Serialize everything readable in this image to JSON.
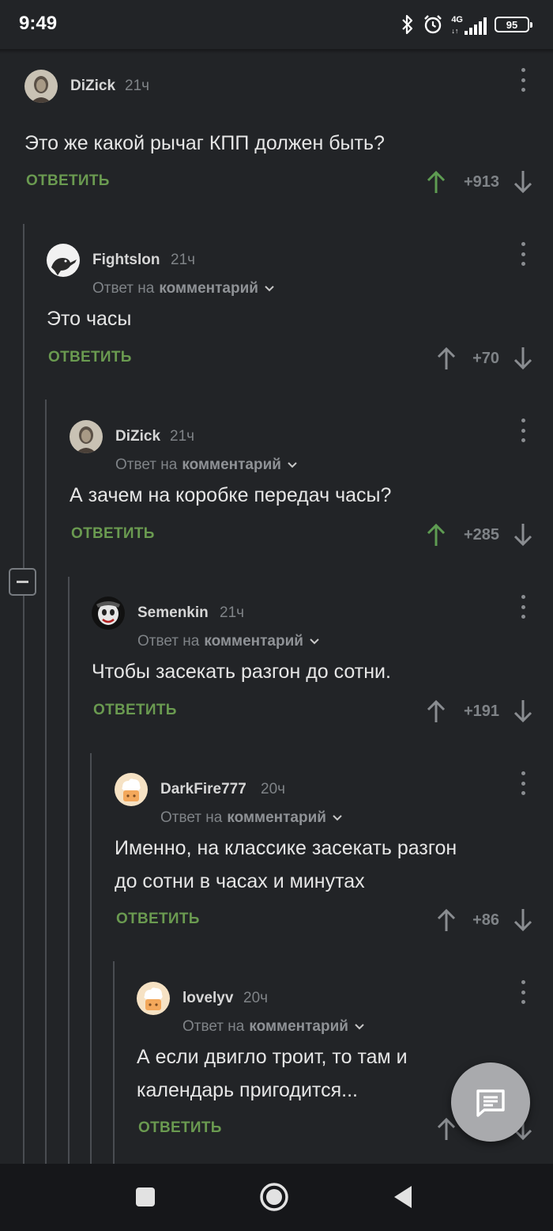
{
  "status_bar": {
    "time": "9:49",
    "network": "4G",
    "battery": "95",
    "icons": [
      "bluetooth-icon",
      "alarm-icon",
      "signal-icon",
      "battery-icon"
    ]
  },
  "colors": {
    "background": "#222427",
    "reply_green": "#6a9a50",
    "upvoted_green": "#5e9c52",
    "muted_gray": "#7f8387",
    "text": "#e6e6e6",
    "thread_line": "#4a4d52",
    "fab": "#a9aaad"
  },
  "reply_label": "ОТВЕТИТЬ",
  "reply_to_prefix": "Ответ на",
  "reply_to_target": "комментарий",
  "comments": [
    {
      "author": "DiZick",
      "time": "21ч",
      "text": "Это же какой рычаг КПП должен быть?",
      "rating": "+913",
      "upvoted": true,
      "avatar_icon": "portrait-avatar"
    },
    {
      "author": "Fightslon",
      "time": "21ч",
      "text": "Это часы",
      "rating": "+70",
      "upvoted": false,
      "avatar_icon": "elephant-avatar"
    },
    {
      "author": "DiZick",
      "time": "21ч",
      "text": "А зачем на коробке передач часы?",
      "rating": "+285",
      "upvoted": true,
      "avatar_icon": "portrait-avatar"
    },
    {
      "author": "Semenkin",
      "time": "21ч",
      "text": "Чтобы засекать разгон до сотни.",
      "rating": "+191",
      "upvoted": false,
      "avatar_icon": "clown-avatar"
    },
    {
      "author": "DarkFire777",
      "time": "20ч",
      "text_lines": [
        "Именно, на классике засекать разгон",
        "до сотни в часах и минутах"
      ],
      "rating": "+86",
      "upvoted": false,
      "avatar_icon": "default-avatar"
    },
    {
      "author": "lovelyv",
      "time": "20ч",
      "text_lines": [
        "А если двигло троит, то там и",
        "календарь пригодится..."
      ],
      "rating": "",
      "upvoted": false,
      "avatar_icon": "default-avatar"
    }
  ],
  "fab_icon": "comment-icon",
  "nav_icons": [
    "recents-square-icon",
    "home-circle-icon",
    "back-triangle-icon"
  ]
}
